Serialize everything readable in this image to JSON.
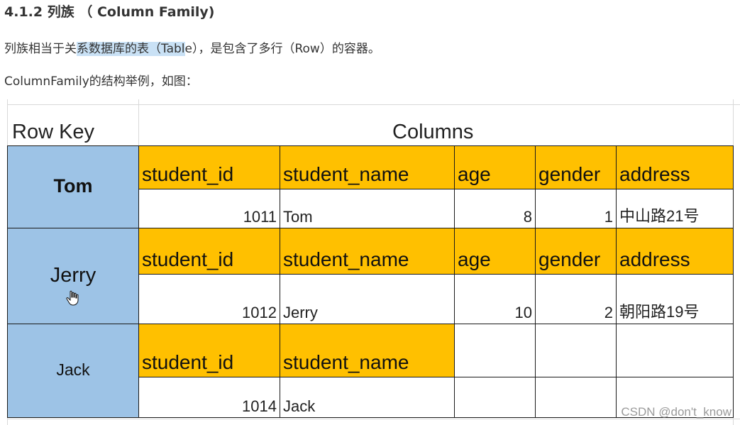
{
  "heading": "4.1.2 列族 （ Column Family)",
  "para1": {
    "before": "列族相当于关",
    "highlight": "系数据库的表（Tabl",
    "after": "e），是包含了多行（Row）的容器。"
  },
  "para2": "ColumnFamily的结构举例，如图：",
  "table": {
    "row_key_header": "Row Key",
    "columns_header": "Columns",
    "rows": [
      {
        "key": "Tom",
        "headers": [
          "student_id",
          "student_name",
          "age",
          "gender",
          "address"
        ],
        "values": [
          "1011",
          "Tom",
          "8",
          "1",
          "中山路21号"
        ]
      },
      {
        "key": "Jerry",
        "headers": [
          "student_id",
          "student_name",
          "age",
          "gender",
          "address"
        ],
        "values": [
          "1012",
          "Jerry",
          "10",
          "2",
          "朝阳路19号"
        ]
      },
      {
        "key": "Jack",
        "headers": [
          "student_id",
          "student_name"
        ],
        "values": [
          "1014",
          "Jack"
        ]
      }
    ]
  },
  "watermark": "CSDN @don't_know",
  "colors": {
    "row_key_fill": "#9dc3e6",
    "header_fill": "#ffc000",
    "highlight": "#c9e1f5"
  },
  "icons": [
    "hand-cursor-icon"
  ]
}
